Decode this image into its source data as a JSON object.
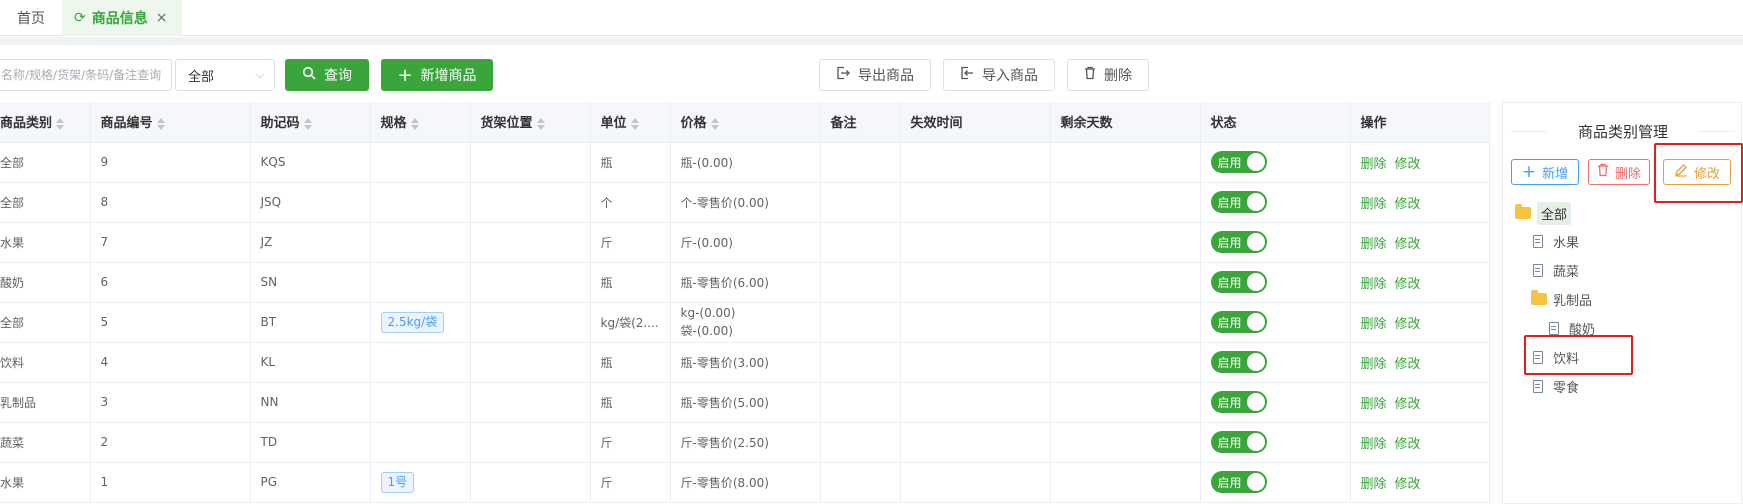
{
  "tabs": {
    "home": "首页",
    "active": "商品信息",
    "refresh_icon": "⟳",
    "close_icon": "×"
  },
  "toolbar": {
    "search_placeholder": "名称/规格/货架/条码/备注查询",
    "filter_value": "全部",
    "query_label": "查询",
    "add_label": "新增商品",
    "export_label": "导出商品",
    "import_label": "导入商品",
    "delete_label": "删除"
  },
  "table": {
    "headers": [
      "商品类别",
      "商品编号",
      "助记码",
      "规格",
      "货架位置",
      "单位",
      "价格",
      "备注",
      "失效时间",
      "剩余天数",
      "状态",
      "操作"
    ],
    "rows": [
      {
        "category": "全部",
        "code": "9",
        "mnemonic": "KQS",
        "spec": "",
        "shelf": "",
        "unit": "瓶",
        "price": [
          "瓶-(0.00)"
        ],
        "note": "",
        "expire": "",
        "days": "",
        "status": "启用"
      },
      {
        "category": "全部",
        "code": "8",
        "mnemonic": "JSQ",
        "spec": "",
        "shelf": "",
        "unit": "个",
        "price": [
          "个-零售价(0.00)"
        ],
        "note": "",
        "expire": "",
        "days": "",
        "status": "启用"
      },
      {
        "category": "水果",
        "code": "7",
        "mnemonic": "JZ",
        "spec": "",
        "shelf": "",
        "unit": "斤",
        "price": [
          "斤-(0.00)"
        ],
        "note": "",
        "expire": "",
        "days": "",
        "status": "启用"
      },
      {
        "category": "酸奶",
        "code": "6",
        "mnemonic": "SN",
        "spec": "",
        "shelf": "",
        "unit": "瓶",
        "price": [
          "瓶-零售价(6.00)"
        ],
        "note": "",
        "expire": "",
        "days": "",
        "status": "启用"
      },
      {
        "category": "全部",
        "code": "5",
        "mnemonic": "BT",
        "spec": "2.5kg/袋",
        "shelf": "",
        "unit": "kg/袋(2....",
        "price": [
          "kg-(0.00)",
          "袋-(0.00)"
        ],
        "note": "",
        "expire": "",
        "days": "",
        "status": "启用"
      },
      {
        "category": "饮料",
        "code": "4",
        "mnemonic": "KL",
        "spec": "",
        "shelf": "",
        "unit": "瓶",
        "price": [
          "瓶-零售价(3.00)"
        ],
        "note": "",
        "expire": "",
        "days": "",
        "status": "启用"
      },
      {
        "category": "乳制品",
        "code": "3",
        "mnemonic": "NN",
        "spec": "",
        "shelf": "",
        "unit": "瓶",
        "price": [
          "瓶-零售价(5.00)"
        ],
        "note": "",
        "expire": "",
        "days": "",
        "status": "启用"
      },
      {
        "category": "蔬菜",
        "code": "2",
        "mnemonic": "TD",
        "spec": "",
        "shelf": "",
        "unit": "斤",
        "price": [
          "斤-零售价(2.50)"
        ],
        "note": "",
        "expire": "",
        "days": "",
        "status": "启用"
      },
      {
        "category": "水果",
        "code": "1",
        "mnemonic": "PG",
        "spec": "1号",
        "shelf": "",
        "unit": "斤",
        "price": [
          "斤-零售价(8.00)"
        ],
        "note": "",
        "expire": "",
        "days": "",
        "status": "启用"
      }
    ],
    "op_delete": "删除",
    "op_edit": "修改"
  },
  "category_panel": {
    "title": "商品类别管理",
    "add_label": "新增",
    "delete_label": "删除",
    "edit_label": "修改",
    "tree": [
      {
        "label": "全部",
        "type": "folder",
        "level": 0
      },
      {
        "label": "水果",
        "type": "doc",
        "level": 1
      },
      {
        "label": "蔬菜",
        "type": "doc",
        "level": 1
      },
      {
        "label": "乳制品",
        "type": "folder",
        "level": 1
      },
      {
        "label": "酸奶",
        "type": "doc",
        "level": 2
      },
      {
        "label": "饮料",
        "type": "doc",
        "level": 1
      },
      {
        "label": "零食",
        "type": "doc",
        "level": 1
      }
    ]
  },
  "colors": {
    "primary_green": "#3aa53a",
    "highlight_red": "#e02020",
    "info_blue": "#409eff",
    "danger_red": "#f56c6c",
    "warning_orange": "#e6a23c"
  }
}
